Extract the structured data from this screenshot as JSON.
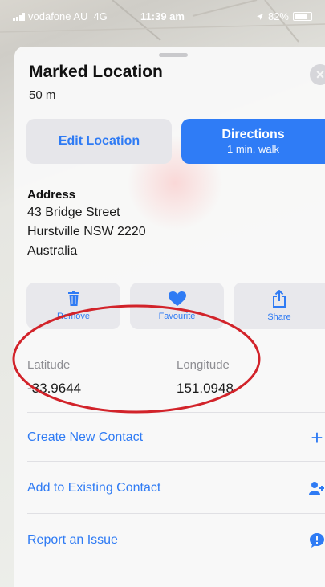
{
  "status": {
    "carrier": "vodafone AU",
    "network": "4G",
    "time": "11:39 am",
    "battery": "82%",
    "battery_level": 0.82
  },
  "card": {
    "title": "Marked Location",
    "distance": "50 m",
    "edit_label": "Edit Location",
    "directions_label": "Directions",
    "directions_sub": "1 min. walk"
  },
  "address": {
    "heading": "Address",
    "lines": [
      "43 Bridge Street",
      "Hurstville NSW 2220",
      "Australia"
    ]
  },
  "actions": [
    {
      "label": "Remove",
      "icon": "trash-icon"
    },
    {
      "label": "Favourite",
      "icon": "heart-icon"
    },
    {
      "label": "Share",
      "icon": "share-icon"
    }
  ],
  "coordinates": {
    "latitude_label": "Latitude",
    "latitude_value": "-33.9644",
    "longitude_label": "Longitude",
    "longitude_value": "151.0948"
  },
  "list": [
    {
      "label": "Create New Contact",
      "icon": "plus-icon"
    },
    {
      "label": "Add to Existing Contact",
      "icon": "add-person-icon"
    },
    {
      "label": "Report an Issue",
      "icon": "speech-bubble-icon"
    }
  ],
  "colors": {
    "accent": "#2f7cf6",
    "annotation": "#d2232a"
  }
}
